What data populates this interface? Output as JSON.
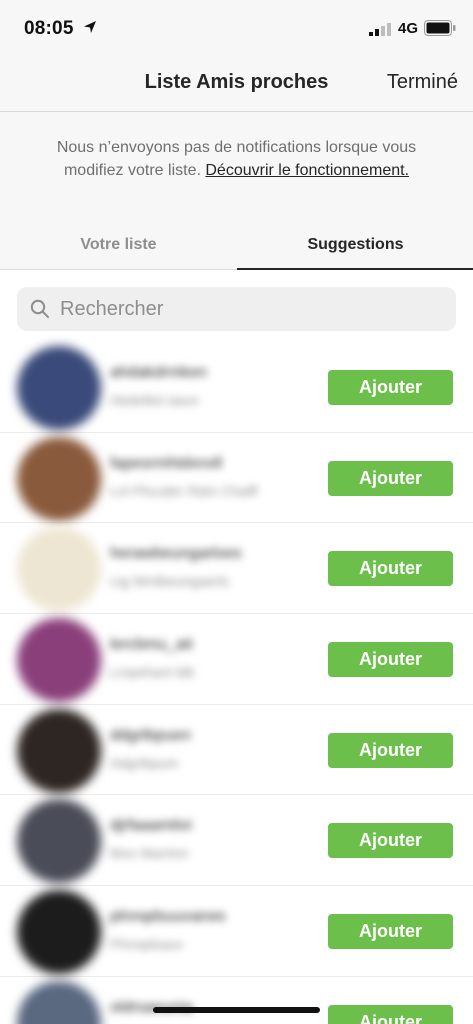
{
  "status_bar": {
    "time": "08:05",
    "network": "4G"
  },
  "nav": {
    "title": "Liste Amis proches",
    "done_label": "Terminé"
  },
  "notice": {
    "text": "Nous n’envoyons pas de notifications lorsque vous modifiez votre liste. ",
    "link": "Découvrir le fonctionnement."
  },
  "tabs": [
    {
      "label": "Votre liste",
      "active": false
    },
    {
      "label": "Suggestions",
      "active": true
    }
  ],
  "search": {
    "placeholder": "Rechercher"
  },
  "suggestions": [
    {
      "username": "ahdakdrmken",
      "name": "Abdelikd aaun",
      "button": "Ajouter",
      "avatar_color": "#3a4a7a"
    },
    {
      "username": "fapesrmhtdxnxll",
      "name": "Lnl Pfxcafer Rdm Chalff",
      "button": "Ajouter",
      "avatar_color": "#8a5a3c"
    },
    {
      "username": "herawbeungarloes",
      "name": "Ltg Mmlbeungaerls",
      "button": "Ajouter",
      "avatar_color": "#ede6d2"
    },
    {
      "username": "lercbmu_ati",
      "name": "Lmpehanl ldtt",
      "button": "Ajouter",
      "avatar_color": "#8a3f7a"
    },
    {
      "username": "ddgrtbpuen",
      "name": "Adgrtbpum",
      "button": "Ajouter",
      "avatar_color": "#2e2622"
    },
    {
      "username": "djrfaaamtivi",
      "name": "Mox Marrtnn",
      "button": "Ajouter",
      "avatar_color": "#4a4c58"
    },
    {
      "username": "plnnqdsuuvarws",
      "name": "Plnnqdsauv",
      "button": "Ajouter",
      "avatar_color": "#1c1c1c"
    },
    {
      "username": "oldrsaeunia",
      "name": "",
      "button": "Ajouter",
      "avatar_color": "#5a6880"
    }
  ]
}
